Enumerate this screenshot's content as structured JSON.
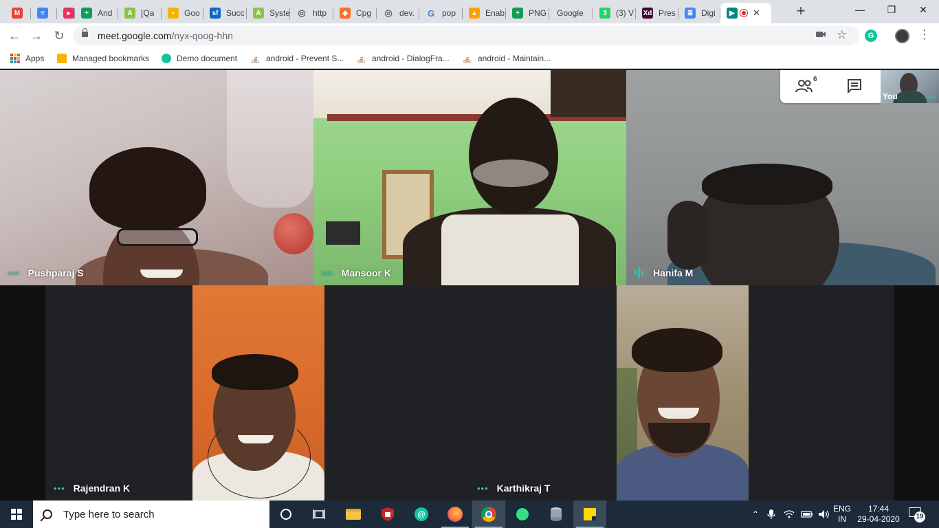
{
  "browser": {
    "tabs": [
      {
        "label": "",
        "icon": "gmail-icon",
        "color": "#ea4335"
      },
      {
        "label": "",
        "icon": "stack-icon",
        "color": "#4285f4"
      },
      {
        "label": "",
        "icon": "media-icon",
        "color": "#e8335c"
      },
      {
        "label": "And",
        "icon": "sheets-icon",
        "color": "#0f9d58"
      },
      {
        "label": "[Qa",
        "icon": "android-icon",
        "color": "#8bc34a"
      },
      {
        "label": "Goo",
        "icon": "keep-icon",
        "color": "#f4b400"
      },
      {
        "label": "Succ",
        "icon": "salesforce-icon",
        "color": "#0a66c2"
      },
      {
        "label": "Syste",
        "icon": "android-icon",
        "color": "#8bc34a"
      },
      {
        "label": "http",
        "icon": "globe-icon",
        "color": "#5f6368"
      },
      {
        "label": "Cpg",
        "icon": "gitlab-icon",
        "color": "#fc6d26"
      },
      {
        "label": "dev.",
        "icon": "globe-icon",
        "color": "#5f6368"
      },
      {
        "label": "pop",
        "icon": "google-icon",
        "color": "#4285f4"
      },
      {
        "label": "Enab",
        "icon": "firebase-icon",
        "color": "#ffa000"
      },
      {
        "label": "PNG",
        "icon": "sheets-icon",
        "color": "#0f9d58"
      },
      {
        "label": "Google",
        "icon": "",
        "color": "#dee1e6"
      },
      {
        "label": "(3) V",
        "icon": "whatsapp-icon",
        "color": "#25d366"
      },
      {
        "label": "Pres",
        "icon": "xd-icon",
        "color": "#470137"
      },
      {
        "label": "Digi",
        "icon": "docs-icon",
        "color": "#4285f4"
      },
      {
        "label": "",
        "icon": "meet-icon",
        "color": "#00897b"
      }
    ],
    "active_close": "✕",
    "new_tab": "+",
    "window": {
      "minimize": "—",
      "restore": "❐",
      "close": "✕"
    },
    "nav": {
      "back": "←",
      "forward": "→",
      "reload": "↻"
    },
    "address": {
      "host": "meet.google.com",
      "path": "/nyx-qoog-hhn"
    },
    "grammarly": "G",
    "bookmarks": [
      {
        "label": "Apps"
      },
      {
        "label": "Managed bookmarks"
      },
      {
        "label": "Demo document"
      },
      {
        "label": "android - Prevent S..."
      },
      {
        "label": "android - DialogFra..."
      },
      {
        "label": "android - Maintain..."
      }
    ]
  },
  "meet": {
    "participants_count": "6",
    "participants": [
      {
        "name": "Pushparaj S",
        "status": "dots"
      },
      {
        "name": "Mansoor K",
        "status": "dots"
      },
      {
        "name": "Hanifa M",
        "status": "speaking"
      },
      {
        "name": "Rajendran K",
        "status": "dots"
      },
      {
        "name": "Karthikraj T",
        "status": "dots"
      }
    ],
    "self_label": "You",
    "dots": "•••"
  },
  "taskbar": {
    "search_placeholder": "Type here to search",
    "lang_top": "ENG",
    "lang_bottom": "IN",
    "time": "17:44",
    "date": "29-04-2020",
    "notifications": "19"
  }
}
